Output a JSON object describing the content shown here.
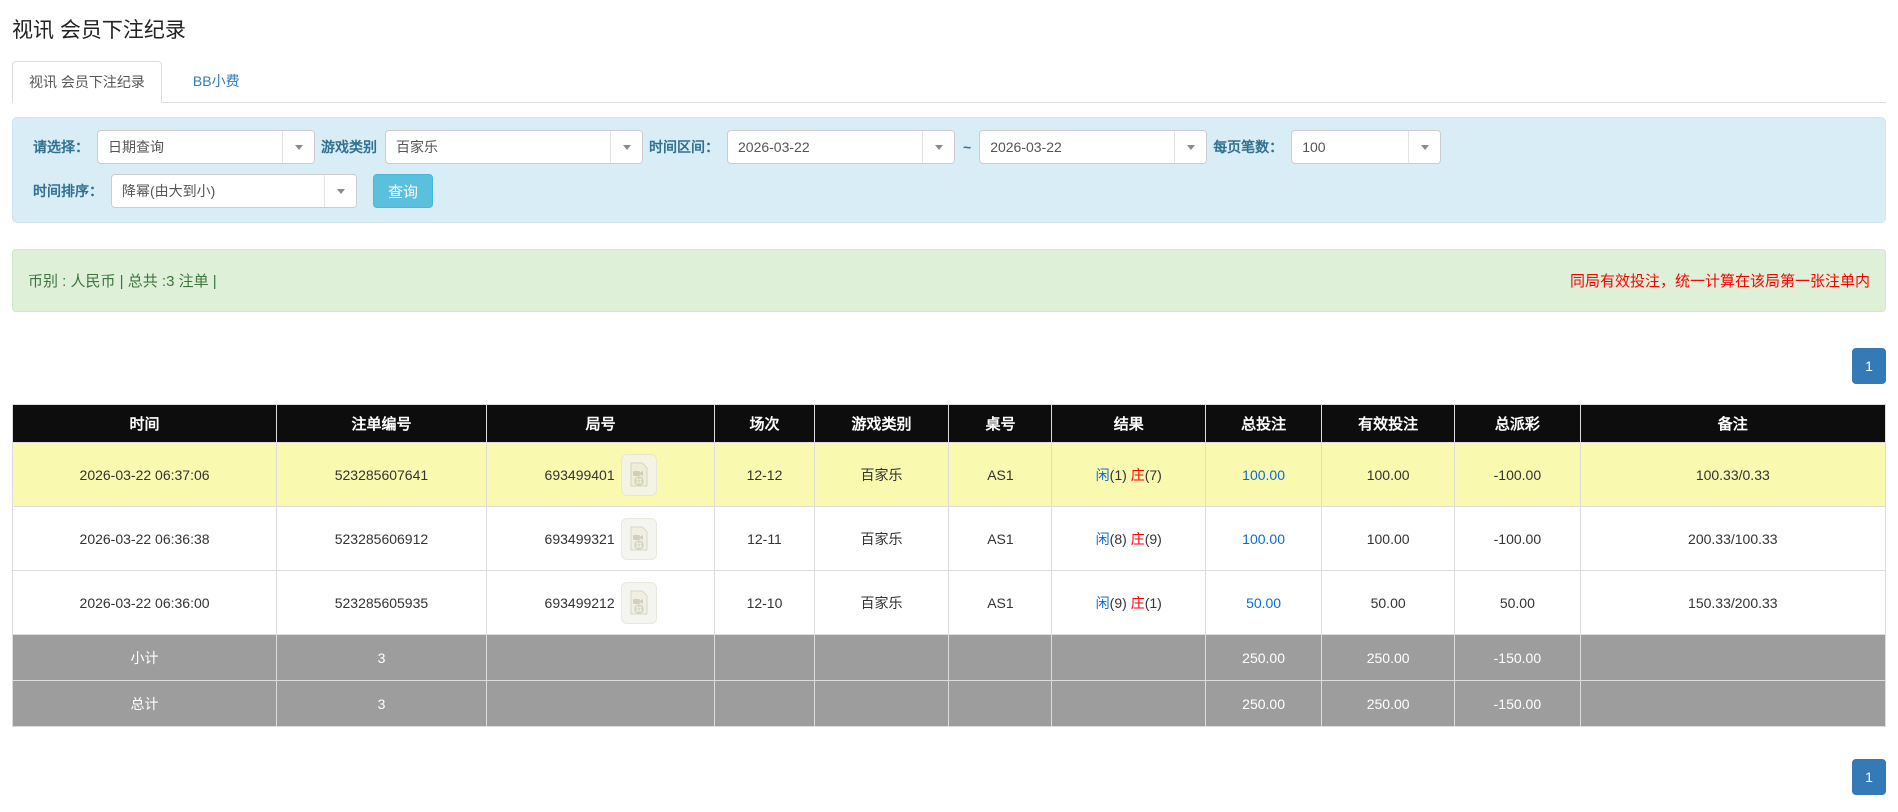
{
  "page": {
    "title": "视讯 会员下注纪录"
  },
  "tabs": {
    "active": "视讯 会员下注纪录",
    "bb_tip": "BB小费"
  },
  "filters": {
    "select_label": "请选择：",
    "select_value": "日期查询",
    "game_type_label": "游戏类别",
    "game_type_value": "百家乐",
    "time_range_label": "时间区间：",
    "time_from": "2026-03-22",
    "tilde": "~",
    "time_to": "2026-03-22",
    "per_page_label": "每页笔数：",
    "per_page_value": "100",
    "sort_label": "时间排序：",
    "sort_value": "降幂(由大到小)",
    "query_button": "查询"
  },
  "summary": {
    "left": "币别 : 人民币 | 总共 :3 注单 |",
    "notice": "同局有效投注，统一计算在该局第一张注单内"
  },
  "pagination": {
    "page": "1"
  },
  "colors": {
    "accent_blue": "#337ab7",
    "link_blue": "#0a6cd6",
    "negative_red": "#ff0000",
    "highlight_yellow": "#f9f9b0",
    "header_black": "#0d0d0d",
    "total_gray": "#9d9d9d"
  },
  "icons": {
    "video_replay": "video-replay-icon",
    "dropdown_arrow": "chevron-down-icon"
  },
  "table": {
    "headers": [
      "时间",
      "注单编号",
      "局号",
      "场次",
      "游戏类别",
      "桌号",
      "结果",
      "总投注",
      "有效投注",
      "总派彩",
      "备注"
    ],
    "rows": [
      {
        "time": "2026-03-22 06:37:06",
        "bet_id": "523285607641",
        "round_id": "693499401",
        "session": "12-12",
        "game": "百家乐",
        "table_no": "AS1",
        "result_p_label": "闲",
        "result_p_num": "(1)",
        "result_b_label": "庄",
        "result_b_num": "(7)",
        "total_bet": "100.00",
        "valid_bet": "100.00",
        "payout": "-100.00",
        "remark": "100.33/0.33"
      },
      {
        "time": "2026-03-22 06:36:38",
        "bet_id": "523285606912",
        "round_id": "693499321",
        "session": "12-11",
        "game": "百家乐",
        "table_no": "AS1",
        "result_p_label": "闲",
        "result_p_num": "(8)",
        "result_b_label": "庄",
        "result_b_num": "(9)",
        "total_bet": "100.00",
        "valid_bet": "100.00",
        "payout": "-100.00",
        "remark": "200.33/100.33"
      },
      {
        "time": "2026-03-22 06:36:00",
        "bet_id": "523285605935",
        "round_id": "693499212",
        "session": "12-10",
        "game": "百家乐",
        "table_no": "AS1",
        "result_p_label": "闲",
        "result_p_num": "(9)",
        "result_b_label": "庄",
        "result_b_num": "(1)",
        "total_bet": "50.00",
        "valid_bet": "50.00",
        "payout": "50.00",
        "remark": "150.33/200.33"
      }
    ],
    "footer": [
      {
        "label": "小计",
        "count": "3",
        "total_bet": "250.00",
        "valid_bet": "250.00",
        "payout": "-150.00"
      },
      {
        "label": "总计",
        "count": "3",
        "total_bet": "250.00",
        "valid_bet": "250.00",
        "payout": "-150.00"
      }
    ]
  }
}
